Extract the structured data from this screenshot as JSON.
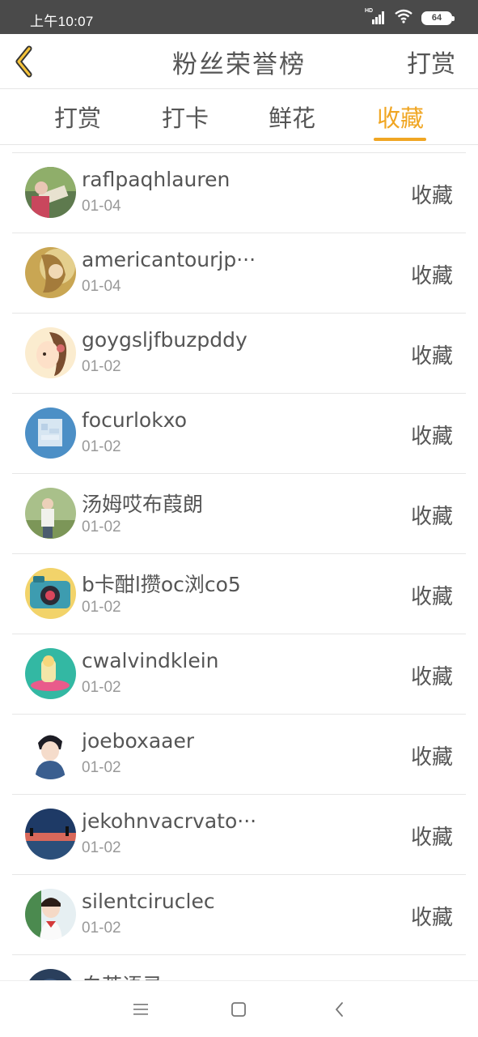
{
  "status_bar": {
    "time": "上午10:07",
    "hd_label": "HD",
    "battery": "64",
    "icons": [
      "signal-icon",
      "wifi-icon",
      "battery-icon"
    ]
  },
  "header": {
    "title": "粉丝荣誉榜",
    "right_action": "打赏",
    "back_icon": "chevron-left-icon"
  },
  "tabs": [
    {
      "label": "打赏",
      "active": false
    },
    {
      "label": "打卡",
      "active": false
    },
    {
      "label": "鲜花",
      "active": false
    },
    {
      "label": "收藏",
      "active": true
    }
  ],
  "list": [
    {
      "name": "raflpaqhlauren",
      "date": "01-04",
      "action": "收藏"
    },
    {
      "name": "americantourjp···",
      "date": "01-04",
      "action": "收藏"
    },
    {
      "name": "goygsljfbuzpddy",
      "date": "01-02",
      "action": "收藏"
    },
    {
      "name": "focurlokxo",
      "date": "01-02",
      "action": "收藏"
    },
    {
      "name": "汤姆哎布葭朗",
      "date": "01-02",
      "action": "收藏"
    },
    {
      "name": "b卡酣l攒oc浏co5",
      "date": "01-02",
      "action": "收藏"
    },
    {
      "name": "cwalvindklein",
      "date": "01-02",
      "action": "收藏"
    },
    {
      "name": "joeboxaaer",
      "date": "01-02",
      "action": "收藏"
    },
    {
      "name": "jekohnvacrvato···",
      "date": "01-02",
      "action": "收藏"
    },
    {
      "name": "silentciruclec",
      "date": "01-02",
      "action": "收藏"
    },
    {
      "name": "白茶语录",
      "date": "",
      "action": ""
    }
  ],
  "nav_bar": {
    "icons": [
      "menu-icon",
      "home-square-icon",
      "back-chevron-icon"
    ]
  },
  "colors": {
    "accent": "#f0a623",
    "status_bar_bg": "#4a4a4a",
    "divider": "#e6e6e6",
    "text": "#555555",
    "subtext": "#999999"
  }
}
